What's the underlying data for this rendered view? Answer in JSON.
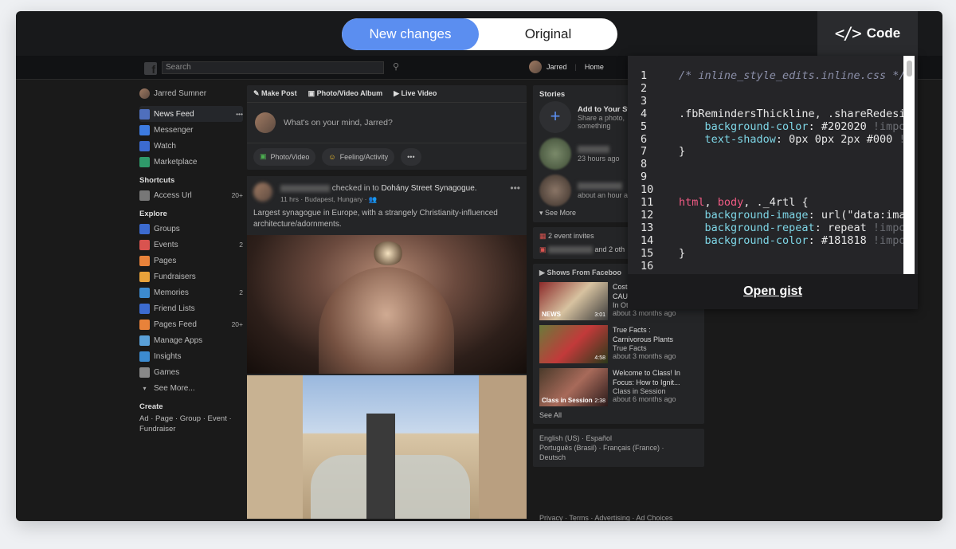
{
  "toggle": {
    "new_label": "New changes",
    "original_label": "Original"
  },
  "code_button": {
    "icon": "</>",
    "label": "Code"
  },
  "fb": {
    "search_placeholder": "Search",
    "top_user": "Jarred",
    "home": "Home",
    "left": {
      "user": "Jarred Sumner",
      "items": [
        {
          "label": "News Feed",
          "count": "•••",
          "color": "#4f6fbd"
        },
        {
          "label": "Messenger",
          "count": "",
          "color": "#3d7be0"
        },
        {
          "label": "Watch",
          "count": "",
          "color": "#3c6bd0"
        },
        {
          "label": "Marketplace",
          "count": "",
          "color": "#2f9a6a"
        }
      ],
      "shortcuts_title": "Shortcuts",
      "shortcuts": [
        {
          "label": "Access Url",
          "count": "20+",
          "color": "#777"
        }
      ],
      "explore_title": "Explore",
      "explore": [
        {
          "label": "Groups",
          "count": "",
          "color": "#3c6bd0"
        },
        {
          "label": "Events",
          "count": "2",
          "color": "#d9534f"
        },
        {
          "label": "Pages",
          "count": "",
          "color": "#e8823a"
        },
        {
          "label": "Fundraisers",
          "count": "",
          "color": "#e8a23a"
        },
        {
          "label": "Memories",
          "count": "2",
          "color": "#3c8bd0"
        },
        {
          "label": "Friend Lists",
          "count": "",
          "color": "#3c6bd0"
        },
        {
          "label": "Pages Feed",
          "count": "20+",
          "color": "#e8823a"
        },
        {
          "label": "Manage Apps",
          "count": "",
          "color": "#5aa0d8"
        },
        {
          "label": "Insights",
          "count": "",
          "color": "#3c8bd0"
        },
        {
          "label": "Games",
          "count": "",
          "color": "#888"
        }
      ],
      "see_more": "See More...",
      "create_title": "Create",
      "create_links": "Ad · Page · Group · Event ·",
      "create_links2": "Fundraiser"
    },
    "composer": {
      "tab1": "Make Post",
      "tab2": "Photo/Video Album",
      "tab3": "Live Video",
      "prompt": "What's on your mind, Jarred?",
      "chip1": "Photo/Video",
      "chip2": "Feeling/Activity",
      "chip3": "•••"
    },
    "post": {
      "checkin": "checked in to",
      "place": "Dohány Street Synagogue.",
      "meta": "11 hrs · Budapest, Hungary ·",
      "text": "Largest synagogue in Europe, with a strangely Christianity-influenced architecture/adornments."
    },
    "right": {
      "stories_title": "Stories",
      "add_story": "Add to Your St",
      "add_story_sub": "Share a photo,",
      "add_story_sub2": "something",
      "story1_time": "23 hours ago",
      "story2_time": "about an hour a",
      "see_more": "See More",
      "event_invites": "2 event invites",
      "and_others": "and 2 oth",
      "shows_title": "Shows From Faceboo",
      "shows": [
        {
          "title": "Costco now sells",
          "title2": "CAULIFLOWER crus...",
          "channel": "In Other News",
          "time": "about 3 months ago",
          "tag": "NEWS",
          "dur": "3:01"
        },
        {
          "title": "True Facts :",
          "title2": "Carnivorous Plants",
          "channel": "True Facts",
          "time": "about 3 months ago",
          "tag": "",
          "dur": "4:58"
        },
        {
          "title": "Welcome to Class! In",
          "title2": "Focus: How to Ignit...",
          "channel": "Class in Session",
          "time": "about 6 months ago",
          "tag": "Class in Session",
          "dur": "2:38"
        }
      ],
      "see_all": "See All",
      "langs1": "English (US) · Español",
      "langs2": "Português (Brasil) · Français (France) ·",
      "langs3": "Deutsch",
      "footer": "Privacy · Terms · Advertising · Ad Choices"
    }
  },
  "code": {
    "line_numbers": "1\n2\n3\n4\n5\n6\n7\n8\n9\n10\n11\n12\n13\n14\n15\n16",
    "comment": "/* inline_style_edits.inline.css */",
    "sel1": ".fbRemindersThickline, .shareRedesig",
    "p1": "background-color",
    "v1": ": #202020 ",
    "i1": "!impor",
    "p2": "text-shadow",
    "v2": ": 0px 0px 2px #000 ",
    "i2": "!i",
    "close": "}",
    "html_kw": "html",
    "body_kw": "body",
    "rtl": ", ._4rtl {",
    "p3": "background-image",
    "v3": ": url(\"data:imag",
    "p4": "background-repeat",
    "v4": ": repeat ",
    "i4": "!impo",
    "p5": "background-color",
    "v5": ": #181818 ",
    "i5": "!impo",
    "gist": "Open gist"
  }
}
